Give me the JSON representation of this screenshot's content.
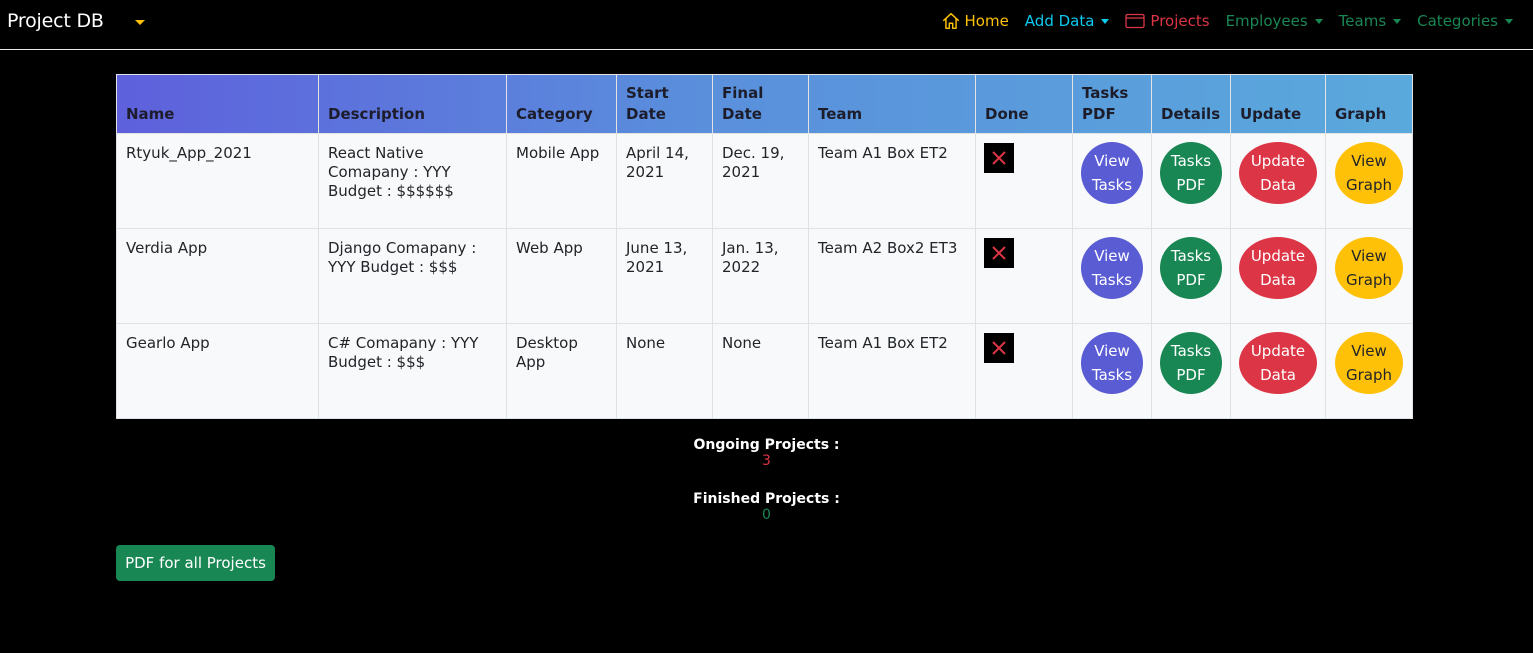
{
  "brand": "Project DB",
  "nav": {
    "home": "Home",
    "add_data": "Add Data",
    "projects": "Projects",
    "employees": "Employees",
    "teams": "Teams",
    "categories": "Categories"
  },
  "table": {
    "headers": [
      "Name",
      "Description",
      "Category",
      "Start Date",
      "Final Date",
      "Team",
      "Done",
      "Tasks PDF",
      "Details",
      "Update",
      "Graph"
    ],
    "rows": [
      {
        "name": "Rtyuk_App_2021",
        "description": "React Native Comapany : YYY Budget : $$$$$$",
        "category": "Mobile App",
        "start": "April 14, 2021",
        "final": "Dec. 19, 2021",
        "team": "Team A1 Box ET2"
      },
      {
        "name": "Verdia App",
        "description": "Django Comapany : YYY Budget : $$$",
        "category": "Web App",
        "start": "June 13, 2021",
        "final": "Jan. 13, 2022",
        "team": "Team A2 Box2 ET3"
      },
      {
        "name": "Gearlo App",
        "description": "C# Comapany : YYY Budget : $$$",
        "category": "Desktop App",
        "start": "None",
        "final": "None",
        "team": "Team A1 Box ET2"
      }
    ],
    "buttons": {
      "view_tasks": "View\nTasks",
      "tasks_pdf": "Tasks\nPDF",
      "update_data": "Update\nData",
      "view_graph": "View\nGraph"
    }
  },
  "summary": {
    "ongoing_label": "Ongoing Projects :",
    "ongoing_value": "3",
    "finished_label": "Finished Projects :",
    "finished_value": "0"
  },
  "pdf_all_label": "PDF for all Projects",
  "colors": {
    "ongoing": "#dc3545",
    "finished": "#198754"
  }
}
